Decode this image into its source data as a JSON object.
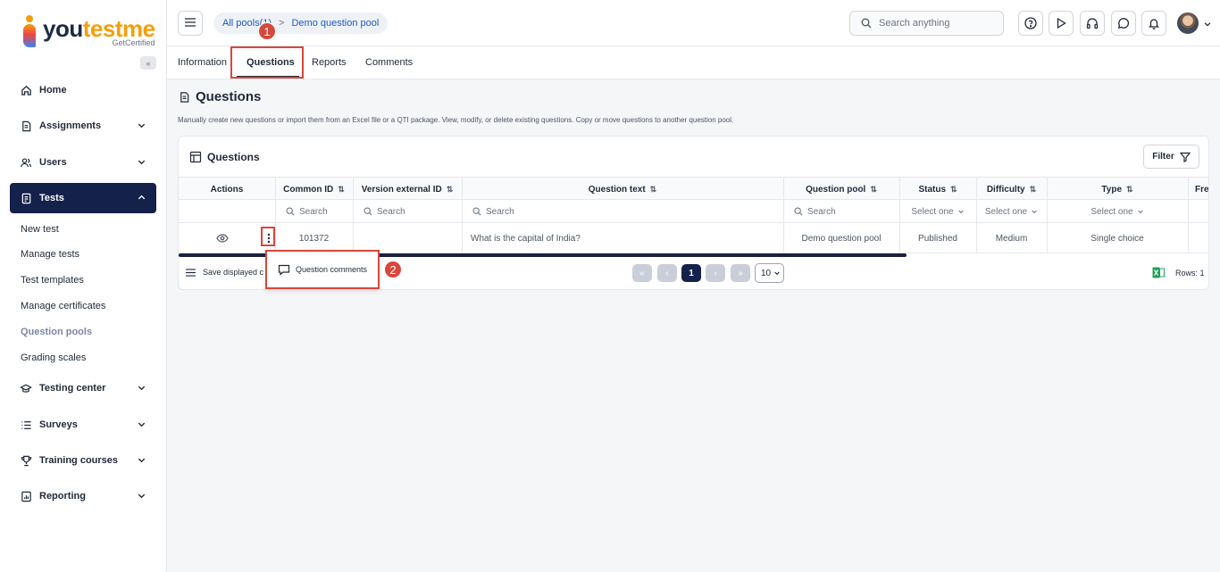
{
  "brand": {
    "name_part1": "you",
    "name_part2": "testme",
    "tagline": "GetCertified"
  },
  "sidebar": {
    "collapse_label": "«",
    "items": [
      {
        "label": "Home",
        "icon": "home-icon"
      },
      {
        "label": "Assignments",
        "icon": "document-icon"
      },
      {
        "label": "Users",
        "icon": "users-icon"
      },
      {
        "label": "Tests",
        "icon": "tests-icon",
        "active": true
      },
      {
        "label": "Testing center",
        "icon": "graduation-cap-icon"
      },
      {
        "label": "Surveys",
        "icon": "list-icon"
      },
      {
        "label": "Training courses",
        "icon": "trophy-icon"
      },
      {
        "label": "Reporting",
        "icon": "report-icon"
      }
    ],
    "sub_items": [
      {
        "label": "New test"
      },
      {
        "label": "Manage tests"
      },
      {
        "label": "Test templates"
      },
      {
        "label": "Manage certificates"
      },
      {
        "label": "Question pools",
        "current": true
      },
      {
        "label": "Grading scales"
      }
    ]
  },
  "topbar": {
    "breadcrumb": {
      "parent": "All pools(1)",
      "separator": ">",
      "current": "Demo question pool"
    },
    "search_placeholder": "Search anything"
  },
  "tabs": [
    {
      "label": "Information"
    },
    {
      "label": "Questions",
      "active": true
    },
    {
      "label": "Reports"
    },
    {
      "label": "Comments"
    }
  ],
  "annotations": {
    "step1": "1",
    "step2": "2"
  },
  "page": {
    "title": "Questions",
    "description": "Manually create new questions or import them from an Excel file or a QTI package. View, modify, or delete existing questions. Copy or move questions to another question pool."
  },
  "table": {
    "title": "Questions",
    "filter_label": "Filter",
    "columns": [
      "Actions",
      "Common ID",
      "Version external ID",
      "Question text",
      "Question pool",
      "Status",
      "Difficulty",
      "Type",
      "Fre"
    ],
    "filters": {
      "search": "Search",
      "select": "Select one"
    },
    "rows": [
      {
        "common_id": "101372",
        "version_external_id": "",
        "question_text": "What is the capital of India?",
        "question_pool": "Demo question pool",
        "status": "Published",
        "difficulty": "Medium",
        "type": "Single choice"
      }
    ],
    "context_menu": {
      "item": "Question comments"
    },
    "footer": {
      "save_label": "Save displayed c",
      "current_page": "1",
      "page_size": "10",
      "rows_label": "Rows: 1"
    }
  },
  "colors": {
    "primary_dark": "#14214b",
    "highlight": "#d9463b",
    "link": "#1f58c4"
  }
}
